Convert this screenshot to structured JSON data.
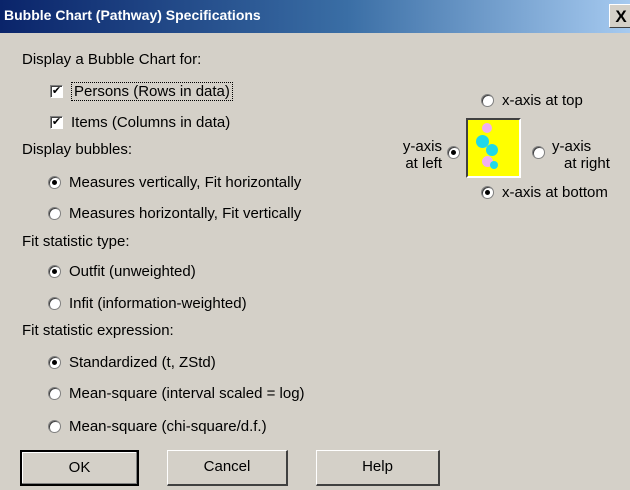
{
  "window": {
    "title": "Bubble Chart (Pathway) Specifications",
    "close_glyph": "X"
  },
  "display_for": {
    "heading": "Display a Bubble Chart for:",
    "persons": {
      "label": "Persons (Rows in data)",
      "checked": true
    },
    "items": {
      "label": "Items (Columns in data)",
      "checked": true
    }
  },
  "display_bubbles": {
    "heading": "Display bubbles:",
    "options": [
      {
        "label": "Measures vertically, Fit horizontally",
        "selected": true
      },
      {
        "label": "Measures horizontally, Fit vertically",
        "selected": false
      }
    ]
  },
  "fit_type": {
    "heading": "Fit statistic type:",
    "options": [
      {
        "label": "Outfit (unweighted)",
        "selected": true
      },
      {
        "label": "Infit (information-weighted)",
        "selected": false
      }
    ]
  },
  "fit_expression": {
    "heading": "Fit statistic expression:",
    "options": [
      {
        "label": "Standardized (t, ZStd)",
        "selected": true
      },
      {
        "label": "Mean-square (interval scaled = log)",
        "selected": false
      },
      {
        "label": "Mean-square (chi-square/d.f.)",
        "selected": false
      }
    ]
  },
  "axis": {
    "x_top": {
      "label": "x-axis at top",
      "selected": false
    },
    "x_bottom": {
      "label": "x-axis at bottom",
      "selected": true
    },
    "y_left": {
      "line1": "y-axis",
      "line2": "at left",
      "selected": true
    },
    "y_right": {
      "line1": "y-axis",
      "line2": "at right",
      "selected": false
    },
    "preview_colors": {
      "background": "#ffff00",
      "bubble_pink": "#f0b0f0",
      "bubble_cyan": "#20d8e8"
    }
  },
  "buttons": {
    "ok": "OK",
    "cancel": "Cancel",
    "help": "Help"
  },
  "icons": {
    "checkbox_check": "✔",
    "close": "close-icon"
  }
}
